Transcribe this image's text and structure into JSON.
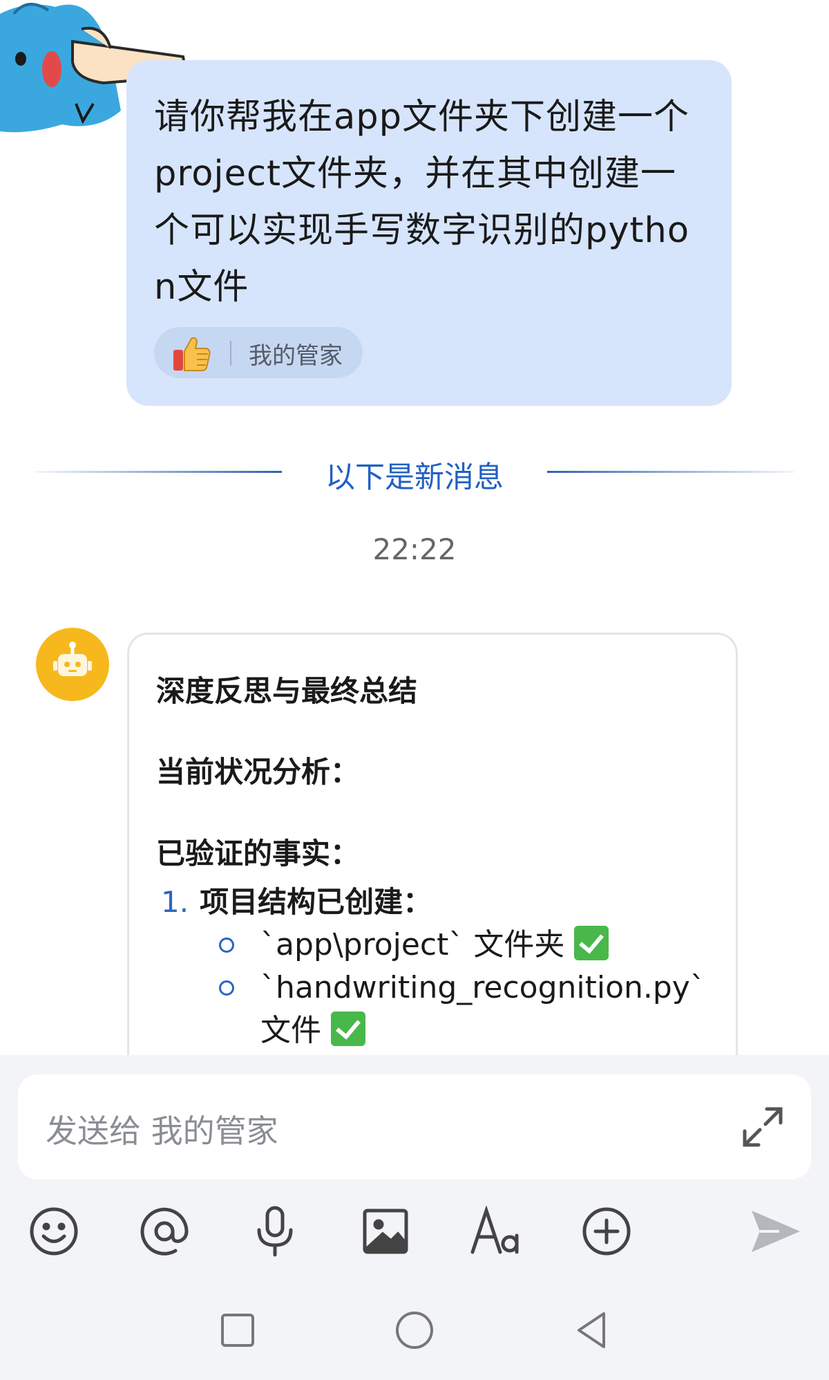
{
  "user_message": {
    "text": "请你帮我在app文件夹下创建一个project文件夹，并在其中创建一个可以实现手写数字识别的python文件",
    "like_chip_label": "我的管家"
  },
  "divider": {
    "label": "以下是新消息"
  },
  "timestamp": "22:22",
  "bot_message": {
    "heading": "深度反思与最终总结",
    "section1": "当前状况分析：",
    "section2": "已验证的事实：",
    "list": [
      {
        "number": "1.",
        "title": "项目结构已创建：",
        "sub_items": [
          {
            "text": "`app\\project` 文件夹"
          },
          {
            "text": "`handwriting_recognition.py` 文件"
          }
        ]
      }
    ]
  },
  "input": {
    "placeholder": "发送给 我的管家"
  },
  "toolbar": {
    "icons": [
      "emoji-icon",
      "mention-icon",
      "microphone-icon",
      "image-icon",
      "text-format-icon",
      "plus-icon",
      "send-icon"
    ]
  },
  "navbar": {
    "icons": [
      "recent-apps-icon",
      "home-icon",
      "back-icon"
    ]
  },
  "colors": {
    "user_bubble": "#d6e5fb",
    "accent": "#2160c4",
    "bot_avatar": "#f6b81c",
    "check": "#48b84a"
  }
}
